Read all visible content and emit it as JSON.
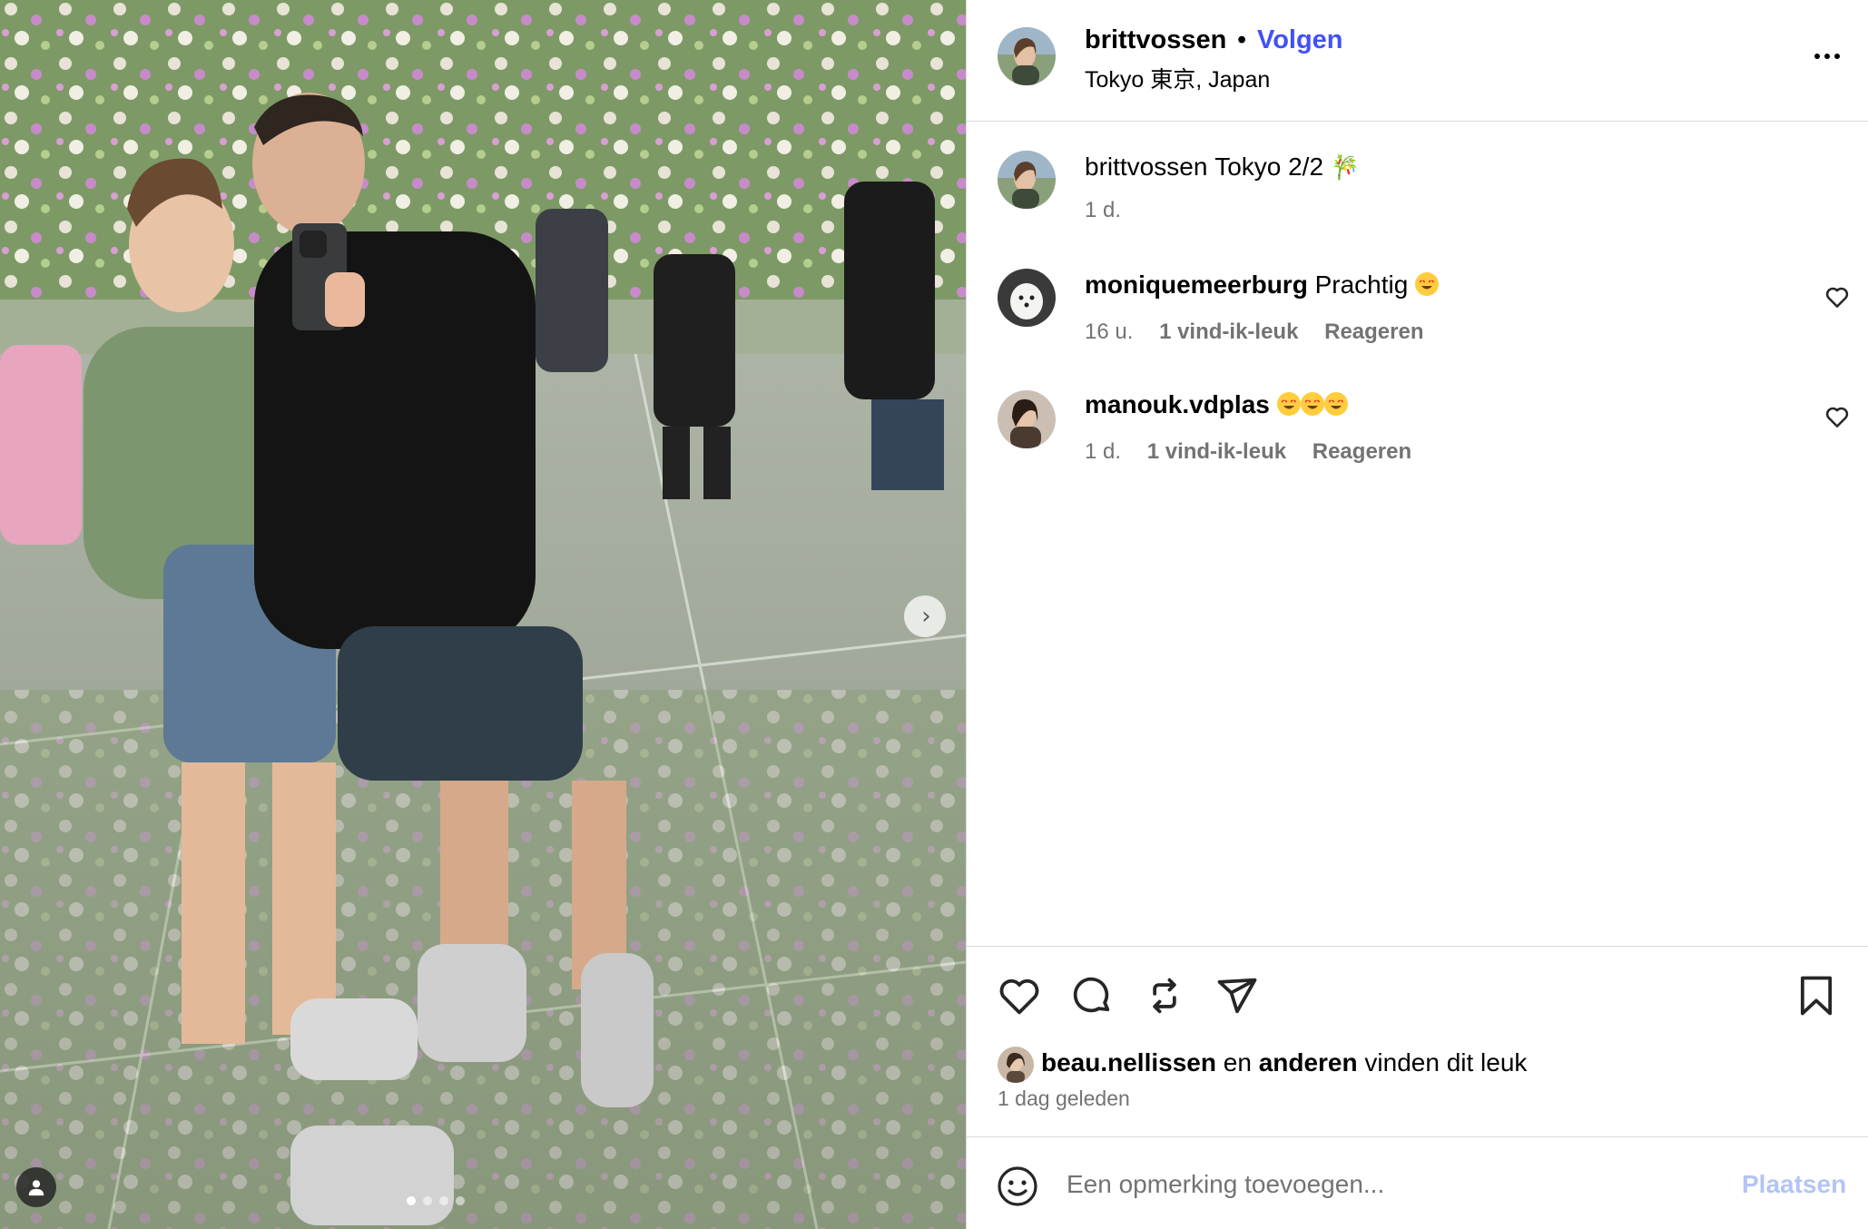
{
  "post": {
    "username": "brittvossen",
    "separator": "•",
    "follow_label": "Volgen",
    "location": "Tokyo 東京, Japan",
    "more_label": "Meer opties"
  },
  "caption": {
    "username": "brittvossen",
    "text": "Tokyo 2/2",
    "emoji": "🎋",
    "time": "1 d."
  },
  "comments": [
    {
      "username": "moniquemeerburg",
      "text": "Prachtig",
      "emoji_count": 1,
      "time": "16 u.",
      "likes": "1 vind-ik-leuk",
      "reply": "Reageren"
    },
    {
      "username": "manouk.vdplas",
      "text": "",
      "emoji_count": 3,
      "time": "1 d.",
      "likes": "1 vind-ik-leuk",
      "reply": "Reageren"
    }
  ],
  "likes": {
    "first_user": "beau.nellissen",
    "connector": "en",
    "others": "anderen",
    "suffix": "vinden dit leuk"
  },
  "posted": "1 dag geleden",
  "composer": {
    "placeholder": "Een opmerking toevoegen...",
    "post_label": "Plaatsen"
  },
  "carousel": {
    "total": 4,
    "active": 0
  },
  "colors": {
    "accent": "#4150f7",
    "muted_text": "#737373",
    "divider": "#dbdbdb",
    "post_disabled": "#b3c4f5"
  },
  "icons": [
    "heart-icon",
    "comment-icon",
    "repost-icon",
    "share-icon",
    "bookmark-icon",
    "emoji-icon",
    "more-icon",
    "chevron-right-icon",
    "user-tag-icon"
  ]
}
